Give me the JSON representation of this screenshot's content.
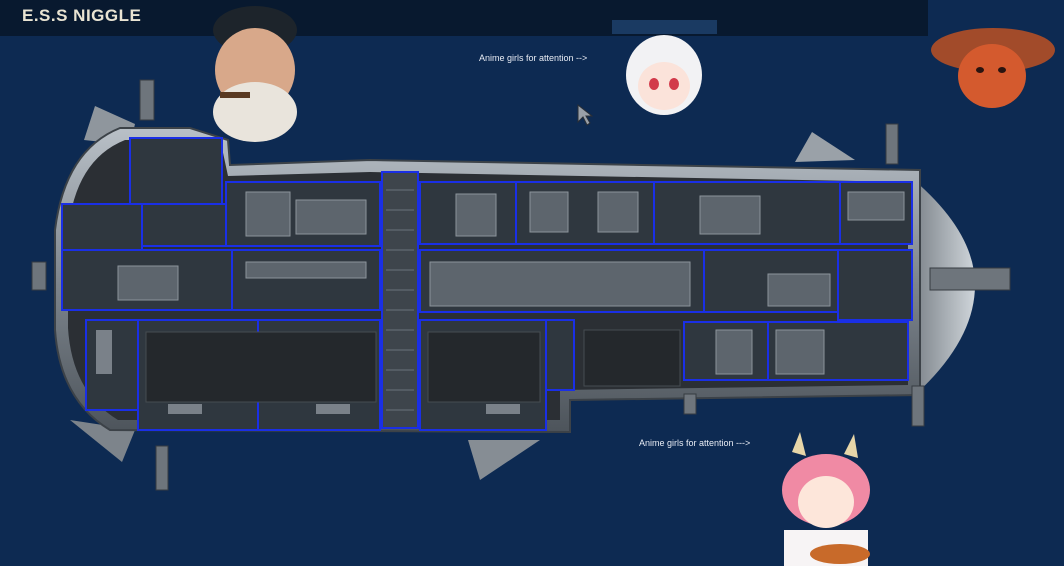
{
  "header": {
    "title": "E.S.S NIGGLE"
  },
  "captions": {
    "top": "Anime girls for attention   -->",
    "bottom": "Anime girls for attention --->"
  },
  "portraits": [
    {
      "name": "sea-captain-portrait",
      "description_icon": "bearded-captain-with-pipe"
    },
    {
      "name": "anime-girl-white-hair-portrait",
      "description_icon": "white-haired-anime-girl"
    },
    {
      "name": "boy-with-hat-portrait",
      "description_icon": "red-faced-boy-in-hat"
    },
    {
      "name": "anime-girl-pink-hair-portrait",
      "description_icon": "pink-haired-fox-girl-eating"
    }
  ],
  "colors": {
    "background": "#0d2a52",
    "topbar": "#08192f",
    "hull": "#8d949c",
    "interior": "#2b2f34",
    "room_outline": "#1a2fe6",
    "room_fill": "#2a3138"
  }
}
